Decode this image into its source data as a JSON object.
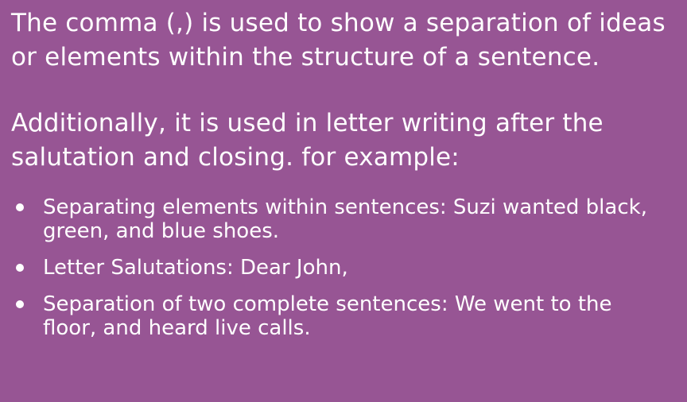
{
  "slide": {
    "paragraph_1": "The comma (,) is used to show a separation of ideas or elements within the structure of a sentence.",
    "paragraph_2": "Additionally, it is used in letter writing after the salutation and closing. for example:",
    "bullets": [
      "Separating elements within sentences: Suzi wanted black, green, and blue shoes.",
      "Letter Salutations: Dear John,",
      "Separation of two complete sentences: We went to the floor, and heard live calls."
    ]
  },
  "colors": {
    "background": "#975594",
    "text": "#ffffff"
  }
}
